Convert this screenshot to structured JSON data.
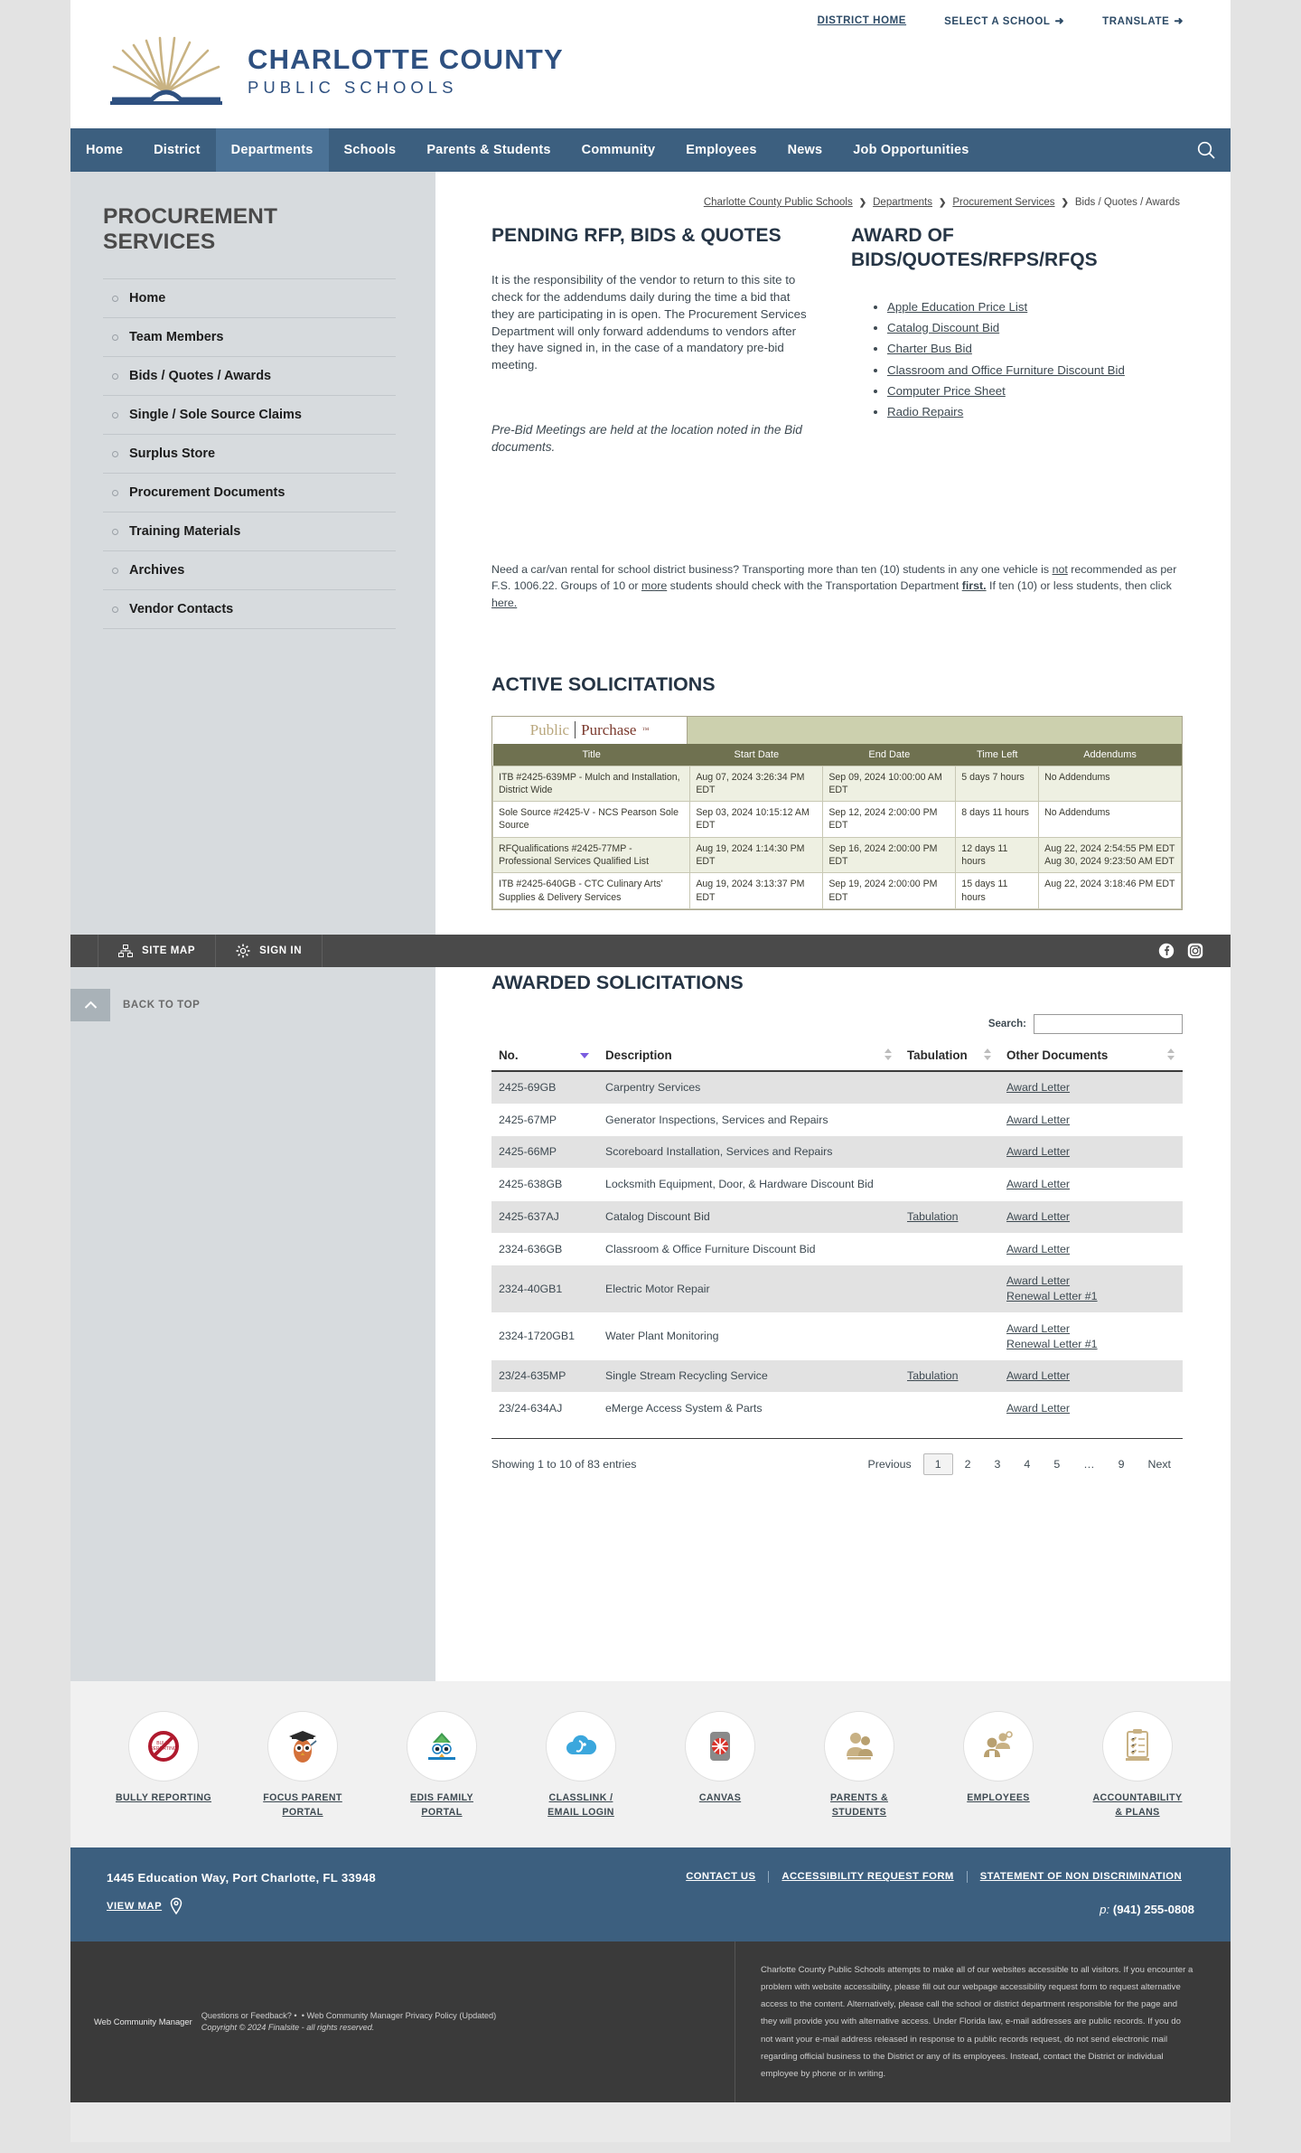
{
  "utility_nav": [
    {
      "label": "DISTRICT HOME",
      "icon": null,
      "underline": true
    },
    {
      "label": "SELECT A SCHOOL",
      "icon": "arrow-right-icon",
      "underline": false
    },
    {
      "label": "TRANSLATE",
      "icon": "arrow-right-icon",
      "underline": false
    }
  ],
  "brand": {
    "line1": "CHARLOTTE COUNTY",
    "line2": "PUBLIC SCHOOLS",
    "logo_icon": "open-book-fan-logo",
    "color_gold": "#c9b383",
    "color_blue": "#2e5080"
  },
  "main_nav": {
    "items": [
      {
        "label": "Home",
        "active": false
      },
      {
        "label": "District",
        "active": false
      },
      {
        "label": "Departments",
        "active": true
      },
      {
        "label": "Schools",
        "active": false
      },
      {
        "label": "Parents & Students",
        "active": false
      },
      {
        "label": "Community",
        "active": false
      },
      {
        "label": "Employees",
        "active": false
      },
      {
        "label": "News",
        "active": false
      },
      {
        "label": "Job Opportunities",
        "active": false
      }
    ],
    "search_icon": "search-icon",
    "bar_color": "#3c5f7f",
    "active_color": "#4b7296"
  },
  "sidebar": {
    "title": "PROCUREMENT SERVICES",
    "items": [
      {
        "label": "Home"
      },
      {
        "label": "Team Members"
      },
      {
        "label": "Bids / Quotes / Awards"
      },
      {
        "label": "Single / Sole Source Claims"
      },
      {
        "label": "Surplus Store"
      },
      {
        "label": "Procurement Documents"
      },
      {
        "label": "Training Materials"
      },
      {
        "label": "Archives"
      },
      {
        "label": "Vendor Contacts"
      }
    ]
  },
  "breadcrumb": [
    {
      "label": "Charlotte County Public Schools",
      "link": true
    },
    {
      "label": "Departments",
      "link": true
    },
    {
      "label": "Procurement Services",
      "link": true
    },
    {
      "label": "Bids / Quotes / Awards",
      "link": false
    }
  ],
  "pending": {
    "heading": "PENDING RFP, BIDS & QUOTES",
    "paragraph": "It is the responsibility of the vendor to return to this site to check for the addendums daily during the time a bid that they are participating in is open. The Procurement Services Department will only forward addendums to vendors after they have signed in, in the case of a mandatory pre-bid meeting.",
    "italic_note": "Pre-Bid Meetings are held at the location noted in the Bid documents."
  },
  "award_of": {
    "heading": "AWARD OF BIDS/QUOTES/RFPS/RFQS",
    "links": [
      "Apple Education Price List",
      "Catalog Discount Bid",
      "Charter Bus Bid",
      "Classroom and Office Furniture Discount Bid",
      "Computer Price Sheet",
      "Radio Repairs"
    ]
  },
  "notice": {
    "p1": "Need a car/van rental for school district business?  Transporting more than ten (10) students in any one vehicle is ",
    "u1": "not",
    "p2": " recommended as per F.S. 1006.22.  Groups of 10 or ",
    "u2": "more",
    "p3": " students should check with the Transportation Department ",
    "b1": "first.",
    "p4": "  If ten (10) or less students, then click ",
    "link": "here."
  },
  "active_solicitations": {
    "heading": "ACTIVE SOLICITATIONS",
    "widget_brand": {
      "part1": "Public",
      "part2": "Purchase",
      "tm": "™"
    },
    "columns": [
      "Title",
      "Start Date",
      "End Date",
      "Time Left",
      "Addendums"
    ],
    "rows": [
      {
        "title": "ITB #2425-639MP - Mulch and Installation, District Wide",
        "start": "Aug 07, 2024 3:26:34 PM EDT",
        "end": "Sep 09, 2024 10:00:00 AM EDT",
        "time_left": "5 days 7 hours",
        "addendums": "No Addendums"
      },
      {
        "title": "Sole Source #2425-V - NCS Pearson Sole Source",
        "start": "Sep 03, 2024 10:15:12 AM EDT",
        "end": "Sep 12, 2024 2:00:00 PM EDT",
        "time_left": "8 days 11 hours",
        "addendums": "No Addendums"
      },
      {
        "title": "RFQualifications #2425-77MP - Professional Services Qualified List",
        "start": "Aug 19, 2024 1:14:30 PM EDT",
        "end": "Sep 16, 2024 2:00:00 PM EDT",
        "time_left": "12 days 11 hours",
        "addendums": "Aug 22, 2024 2:54:55 PM EDT\nAug 30, 2024 9:23:50 AM EDT"
      },
      {
        "title": "ITB #2425-640GB - CTC Culinary Arts' Supplies & Delivery Services",
        "start": "Aug 19, 2024 3:13:37 PM EDT",
        "end": "Sep 19, 2024 2:00:00 PM EDT",
        "time_left": "15 days 11 hours",
        "addendums": "Aug 22, 2024 3:18:46 PM EDT"
      }
    ]
  },
  "awarded_solicitations": {
    "heading": "AWARDED SOLICITATIONS",
    "search_label": "Search:",
    "search_value": "",
    "search_placeholder": "",
    "columns": [
      "No.",
      "Description",
      "Tabulation",
      "Other Documents"
    ],
    "rows": [
      {
        "no": "2425-69GB",
        "description": "Carpentry Services",
        "tabulation": "",
        "documents": [
          "Award Letter"
        ]
      },
      {
        "no": "2425-67MP",
        "description": "Generator Inspections, Services and Repairs",
        "tabulation": "",
        "documents": [
          "Award Letter"
        ]
      },
      {
        "no": "2425-66MP",
        "description": "Scoreboard Installation, Services and Repairs",
        "tabulation": "",
        "documents": [
          "Award Letter"
        ]
      },
      {
        "no": "2425-638GB",
        "description": "Locksmith Equipment, Door, & Hardware Discount Bid",
        "tabulation": "",
        "documents": [
          "Award Letter"
        ]
      },
      {
        "no": "2425-637AJ",
        "description": "Catalog Discount Bid",
        "tabulation": "Tabulation",
        "documents": [
          "Award Letter"
        ]
      },
      {
        "no": "2324-636GB",
        "description": "Classroom & Office Furniture Discount Bid",
        "tabulation": "",
        "documents": [
          "Award Letter"
        ]
      },
      {
        "no": "2324-40GB1",
        "description": "Electric Motor Repair",
        "tabulation": "",
        "documents": [
          "Award Letter",
          "Renewal Letter #1"
        ]
      },
      {
        "no": "2324-1720GB1",
        "description": "Water Plant Monitoring",
        "tabulation": "",
        "documents": [
          "Award Letter",
          "Renewal Letter #1"
        ]
      },
      {
        "no": "23/24-635MP",
        "description": "Single Stream Recycling Service",
        "tabulation": "Tabulation",
        "documents": [
          "Award Letter"
        ]
      },
      {
        "no": "23/24-634AJ",
        "description": "eMerge Access System & Parts",
        "tabulation": "",
        "documents": [
          "Award Letter"
        ]
      }
    ],
    "showing": "Showing 1 to 10 of 83 entries",
    "pager": {
      "previous": "Previous",
      "pages": [
        "1",
        "2",
        "3",
        "4",
        "5",
        "…",
        "9"
      ],
      "current": "1",
      "next": "Next"
    }
  },
  "sticky_bar": {
    "site_map": {
      "label": "SITE MAP",
      "icon": "sitemap-icon"
    },
    "sign_in": {
      "label": "SIGN IN",
      "icon": "gear-icon"
    },
    "social": [
      {
        "name": "facebook-icon"
      },
      {
        "name": "instagram-icon"
      }
    ],
    "back_to_top": {
      "label": "BACK TO TOP",
      "icon": "chevron-up-icon"
    }
  },
  "quicklinks": [
    {
      "label": "BULLY REPORTING",
      "icon": "bully-reporting-icon"
    },
    {
      "label": "FOCUS PARENT PORTAL",
      "icon": "focus-owl-icon"
    },
    {
      "label": "EDIS FAMILY PORTAL",
      "icon": "edis-bird-icon"
    },
    {
      "label": "CLASSLINK / EMAIL LOGIN",
      "icon": "classlink-cloud-icon"
    },
    {
      "label": "CANVAS",
      "icon": "canvas-icon"
    },
    {
      "label": "PARENTS & STUDENTS",
      "icon": "parents-students-icon"
    },
    {
      "label": "EMPLOYEES",
      "icon": "employees-icon"
    },
    {
      "label": "ACCOUNTABILITY & PLANS",
      "icon": "accountability-clipboard-icon"
    }
  ],
  "footer": {
    "address": "1445 Education Way, Port Charlotte, FL 33948",
    "view_map": "VIEW MAP",
    "map_pin_icon": "map-pin-icon",
    "links": [
      "CONTACT US",
      "ACCESSIBILITY REQUEST FORM",
      "STATEMENT OF NON DISCRIMINATION"
    ],
    "phone_prefix": "p:",
    "phone": "(941) 255-0808",
    "wcm_brand": "Web Community Manager",
    "wcm_q": "Questions or Feedback?",
    "wcm_sep1": "•",
    "wcm_privacy": "Web Community Manager Privacy Policy (Updated)",
    "wcm_copyright": "Copyright © 2024 Finalsite - all rights reserved.",
    "accessibility_text": "Charlotte County Public Schools attempts to make all of our websites accessible to all visitors. If you encounter a problem with website accessibility, please fill out our webpage accessibility request form to request alternative access to the content. Alternatively, please call the school or district department responsible for the page and they will provide you with alternative access. Under Florida law, e-mail addresses are public records. If you do not want your e-mail address released in response to a public records request, do not send electronic mail regarding official business to the District or any of its employees. Instead, contact the District or individual employee by phone or in writing."
  }
}
